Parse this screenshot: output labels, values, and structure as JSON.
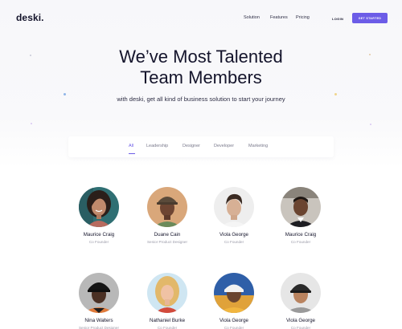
{
  "header": {
    "logo": "deski.",
    "nav": [
      "Solution",
      "Features",
      "Pricing"
    ],
    "login": "LOGIN",
    "cta": "GET STARTED"
  },
  "hero": {
    "title_line1": "We’ve Most Talented",
    "title_line2": "Team Members",
    "subtitle": "with deski, get all kind of business solution to start your journey"
  },
  "tabs": {
    "items": [
      "All",
      "Leadership",
      "Designer",
      "Developer",
      "Marketing"
    ],
    "active": "All"
  },
  "members": [
    {
      "name": "Maurice Craig",
      "role": "Co Founder"
    },
    {
      "name": "Duane Cain",
      "role": "Senior Product Designer"
    },
    {
      "name": "Viola George",
      "role": "Co Founder"
    },
    {
      "name": "Maurice Craig",
      "role": "Co Founder"
    },
    {
      "name": "Nina Walters",
      "role": "Senior Product Designer"
    },
    {
      "name": "Nathaniel Burke",
      "role": "Co Founder"
    },
    {
      "name": "Viola George",
      "role": "Co Founder"
    },
    {
      "name": "Viola George",
      "role": "Co Founder"
    }
  ],
  "colors": {
    "accent": "#6c5ce7",
    "text": "#14142b",
    "muted": "#9a9aa8"
  }
}
